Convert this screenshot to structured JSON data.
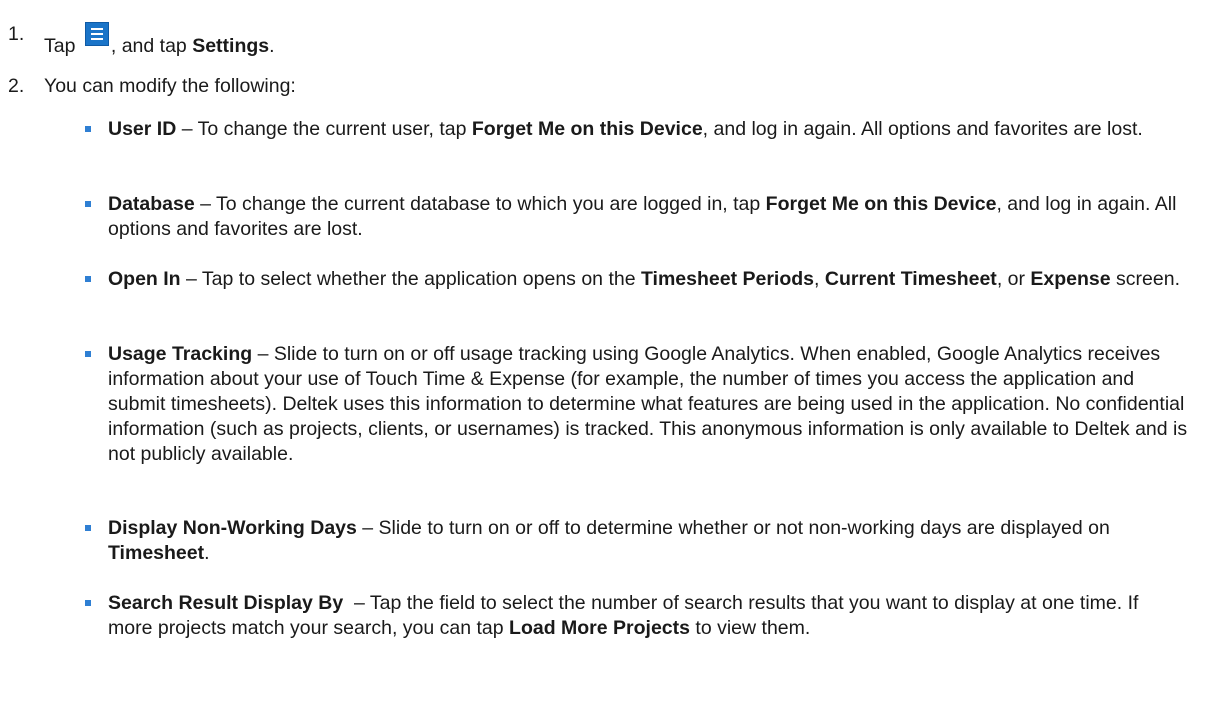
{
  "steps": [
    {
      "num": "1.",
      "t1": "Tap",
      "t2": ", and tap ",
      "b1": "Settings",
      "t3": ".",
      "icon": "hamburger-menu-icon"
    },
    {
      "num": "2.",
      "text": "You can modify the following:"
    }
  ],
  "bullets": [
    {
      "term": "User ID",
      "t1": " – To change the current user, tap ",
      "b1": "Forget Me on this Device",
      "t2": ", and log in again. All options and favorites are lost."
    },
    {
      "term": "Database",
      "t1": " – To change the current database to which you are logged in, tap ",
      "b1": "Forget Me on this Device",
      "t2": ", and log in again. All options and favorites are lost."
    },
    {
      "term": "Open In",
      "t1": " – Tap to select whether the application opens on the ",
      "b1": "Timesheet Periods",
      "t2": ", ",
      "b2": "Current Timesheet",
      "t3": ", or ",
      "b3": "Expense",
      "t4": " screen."
    },
    {
      "term": "Usage Tracking",
      "t1": " – Slide to turn on or off usage tracking using Google Analytics. When enabled, Google Analytics receives information about your use of Touch Time & Expense (for example, the number of times you access the application and submit timesheets). Deltek uses this information to determine what features are being used in the application. No confidential information (such as projects, clients, or usernames) is tracked. This anonymous information is only available to Deltek and is not publicly available."
    },
    {
      "term": "Display Non-Working Days",
      "t1": " – Slide to turn on or off to determine whether or not non-working days are displayed on ",
      "b1": "Timesheet",
      "t2": "."
    },
    {
      "term": "Search Result Display By",
      "t1": "  – Tap the field to select the number of search results that you want to display at one time. If more projects match your search, you can tap ",
      "b1": "Load More Projects",
      "t2": " to view them."
    }
  ],
  "colors": {
    "bullet": "#2f7fd3",
    "icon_bg": "#1a74c8",
    "text": "#1a1a1a"
  }
}
